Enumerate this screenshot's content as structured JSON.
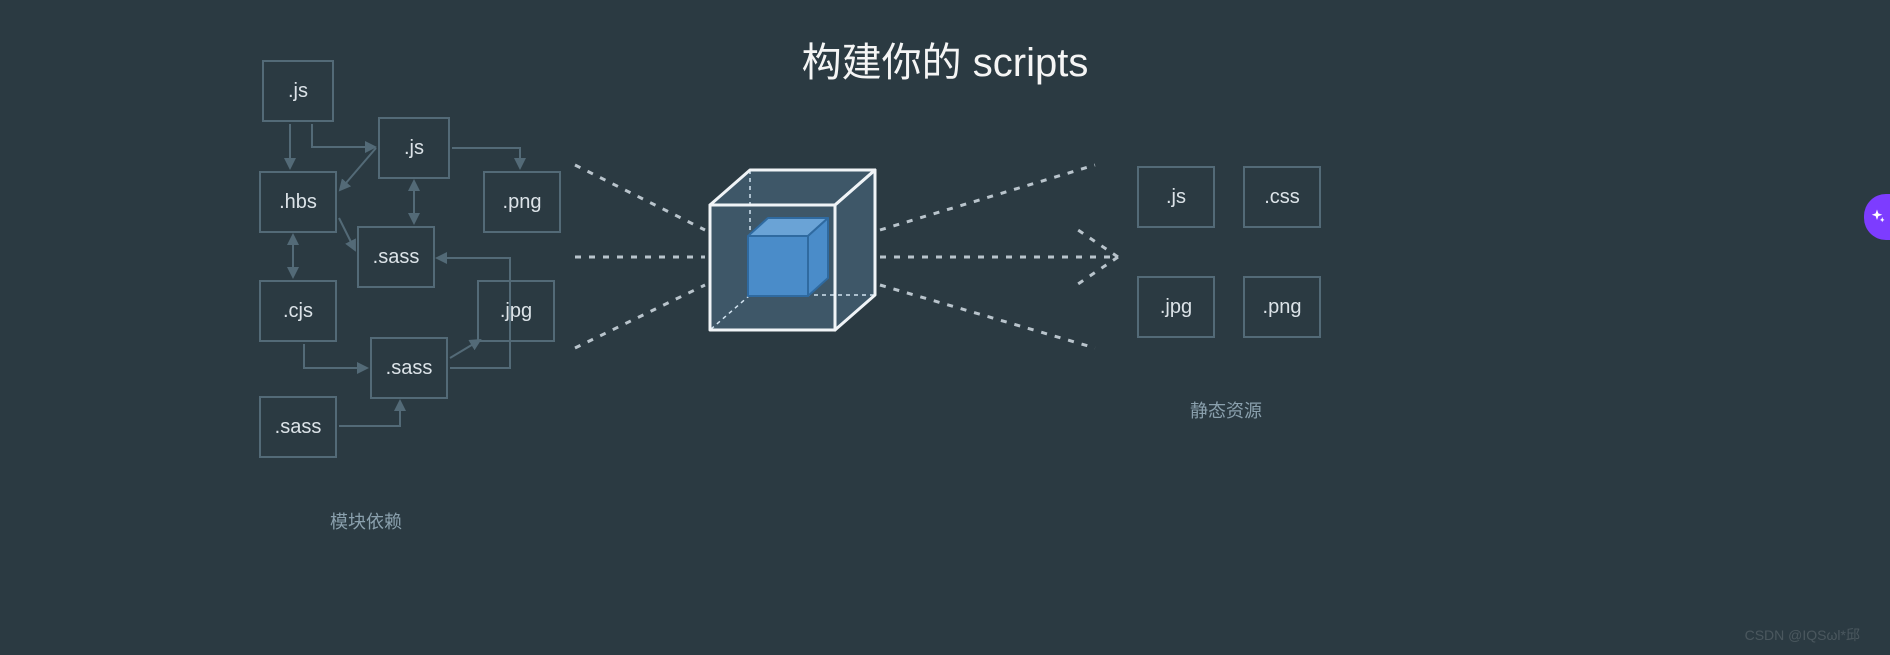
{
  "title": "构建你的 scripts",
  "left_section_label": "模块依赖",
  "right_section_label": "静态资源",
  "watermark": "CSDN @IQSωl*邱",
  "dependency_nodes": {
    "js_root": ".js",
    "js": ".js",
    "hbs": ".hbs",
    "png": ".png",
    "sass1": ".sass",
    "cjs": ".cjs",
    "jpg": ".jpg",
    "sass2": ".sass",
    "sass3": ".sass"
  },
  "output_nodes": {
    "js": ".js",
    "css": ".css",
    "jpg": ".jpg",
    "png": ".png"
  },
  "colors": {
    "background": "#2b3a42",
    "node_border": "#536a77",
    "beam": "#b9c4cc",
    "cube_fill": "#4a8cc9",
    "accent": "#7d3cff"
  },
  "dependency_edges": [
    [
      "js_root",
      "js"
    ],
    [
      "js_root",
      "hbs"
    ],
    [
      "js",
      "png"
    ],
    [
      "js",
      "sass1"
    ],
    [
      "js",
      "hbs"
    ],
    [
      "hbs",
      "sass1"
    ],
    [
      "hbs",
      "cjs"
    ],
    [
      "cjs",
      "sass2"
    ],
    [
      "sass2",
      "sass1"
    ],
    [
      "sass2",
      "jpg"
    ],
    [
      "sass3",
      "sass2"
    ]
  ]
}
